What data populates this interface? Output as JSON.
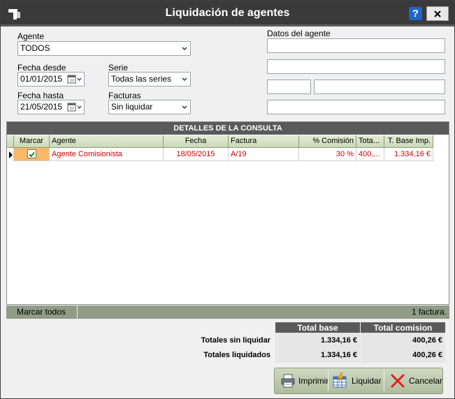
{
  "window": {
    "title": "Liquidación de agentes",
    "help_label": "?"
  },
  "form": {
    "agente_label": "Agente",
    "agente_value": "TODOS",
    "fecha_desde_label": "Fecha desde",
    "fecha_desde_value": "01/01/2015",
    "fecha_hasta_label": "Fecha hasta",
    "fecha_hasta_value": "21/05/2015",
    "serie_label": "Serie",
    "serie_value": "Todas las series",
    "facturas_label": "Facturas",
    "facturas_value": "Sin liquidar",
    "datos_agente_label": "Datos del agente",
    "datos_fields": [
      "",
      "",
      "",
      "",
      ""
    ]
  },
  "grid": {
    "title": "DETALLES DE LA CONSULTA",
    "columns": [
      "Marcar",
      "Agente",
      "Fecha",
      "Factura",
      "% Comisión",
      "Tota...",
      "T. Base Imp."
    ],
    "rows": [
      {
        "marcar": true,
        "agente": "Agente Comisionista",
        "fecha": "18/05/2015",
        "factura": "A/19",
        "comision": "30 %",
        "total": "400,...",
        "base": "1.334,16 €"
      }
    ]
  },
  "footer": {
    "mark_all": "Marcar todos",
    "count": "1 factura."
  },
  "totals": {
    "col_base": "Total base",
    "col_comision": "Total comision",
    "rows": [
      {
        "label": "Totales sin liquidar",
        "base": "1.334,16 €",
        "comision": "400,26 €"
      },
      {
        "label": "Totales liquidados",
        "base": "1.334,16 €",
        "comision": "400,26 €"
      }
    ]
  },
  "buttons": {
    "imprimir": "Imprimir",
    "liquidar": "Liquidar",
    "cancelar": "Cancelar"
  },
  "colors": {
    "titlebar": "#3a3a3a",
    "grid_header": "#cbd9b8",
    "row_text": "#d00000",
    "footer_bar": "#909c86",
    "help": "#1d66c9"
  }
}
